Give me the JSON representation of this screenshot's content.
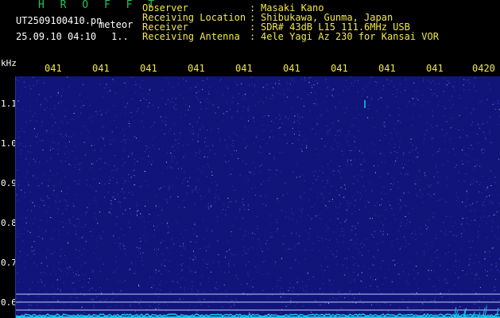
{
  "header": {
    "brand": "H R O F F T",
    "filename": "UT2509100410.pn",
    "suffix": "meteor",
    "timestamp": "25.09.10 04:10",
    "marker": "1..",
    "fields": [
      {
        "label": "Observer",
        "value": "Masaki Kano"
      },
      {
        "label": "Receiving Location",
        "value": "Shibukawa, Gunma, Japan"
      },
      {
        "label": "Receiver",
        "value": "SDR# 43dB L15 111.6MHz USB"
      },
      {
        "label": "Receiving Antenna",
        "value": "4ele Yagi Az 230 for Kansai VOR"
      }
    ],
    "separator": ":"
  },
  "axis": {
    "unit": "kHz",
    "time_ticks": [
      "041",
      "041",
      "041",
      "041",
      "041",
      "041",
      "041",
      "041",
      "041",
      "0420"
    ],
    "freq_ticks": [
      "1.1",
      "1.0",
      "0.9",
      "0.8",
      "0.7",
      "0.6"
    ]
  },
  "colors": {
    "background": "#11157a",
    "label": "#f2e84a",
    "brand": "#22c35a",
    "trace": "#19c9e8",
    "guideline": "#c9c9ff"
  }
}
